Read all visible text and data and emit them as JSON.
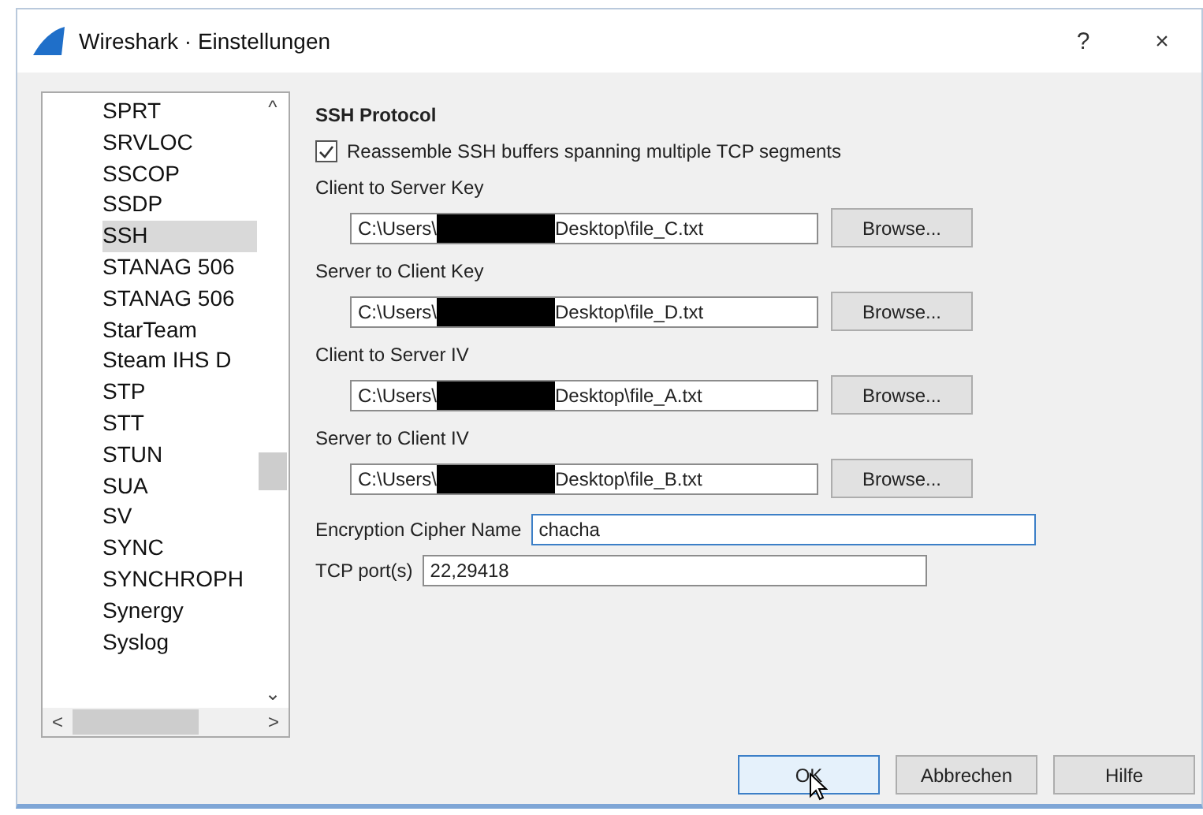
{
  "window": {
    "title": "Wireshark · Einstellungen",
    "help": "?",
    "close": "×"
  },
  "protocol_list": {
    "items": [
      {
        "label": "SPRT",
        "selected": false
      },
      {
        "label": "SRVLOC",
        "selected": false
      },
      {
        "label": "SSCOP",
        "selected": false
      },
      {
        "label": "SSDP",
        "selected": false
      },
      {
        "label": "SSH",
        "selected": true
      },
      {
        "label": "STANAG 506",
        "selected": false
      },
      {
        "label": "STANAG 506",
        "selected": false
      },
      {
        "label": "StarTeam",
        "selected": false
      },
      {
        "label": "Steam IHS D",
        "selected": false
      },
      {
        "label": "STP",
        "selected": false
      },
      {
        "label": "STT",
        "selected": false
      },
      {
        "label": "STUN",
        "selected": false
      },
      {
        "label": "SUA",
        "selected": false
      },
      {
        "label": "SV",
        "selected": false
      },
      {
        "label": "SYNC",
        "selected": false
      },
      {
        "label": "SYNCHROPH",
        "selected": false
      },
      {
        "label": "Synergy",
        "selected": false
      },
      {
        "label": "Syslog",
        "selected": false
      }
    ],
    "scroll_up": "^",
    "scroll_down": "⌄",
    "scroll_left": "<",
    "scroll_right": ">"
  },
  "section": {
    "title": "SSH Protocol",
    "reassemble": {
      "label": "Reassemble SSH buffers spanning multiple TCP segments",
      "checked": true
    },
    "key_files": [
      {
        "label": "Client to Server Key",
        "path_start": "C:\\Users\\",
        "path_end": "Desktop\\file_C.txt",
        "button": "Browse..."
      },
      {
        "label": "Server to Client Key",
        "path_start": "C:\\Users\\",
        "path_end": "Desktop\\file_D.txt",
        "button": "Browse..."
      },
      {
        "label": "Client to Server IV",
        "path_start": "C:\\Users\\",
        "path_end": "Desktop\\file_A.txt",
        "button": "Browse..."
      },
      {
        "label": "Server to Client IV",
        "path_start": "C:\\Users\\",
        "path_end": "Desktop\\file_B.txt",
        "button": "Browse..."
      }
    ],
    "cipher": {
      "label": "Encryption Cipher Name",
      "value": "chacha",
      "focused": true
    },
    "ports": {
      "label": "TCP port(s)",
      "value": "22,29418",
      "focused": false
    }
  },
  "buttons": [
    {
      "label": "OK",
      "kind": "default"
    },
    {
      "label": "Abbrechen",
      "kind": "normal"
    },
    {
      "label": "Hilfe",
      "kind": "normal"
    }
  ]
}
